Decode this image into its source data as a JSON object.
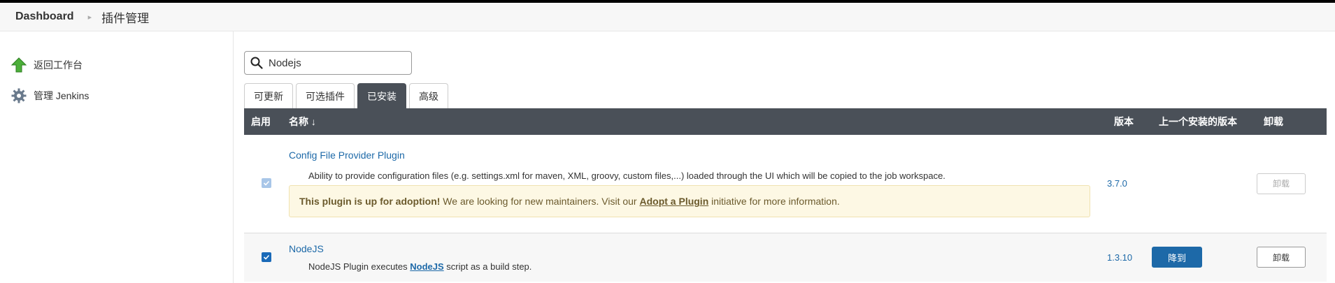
{
  "breadcrumb": {
    "home": "Dashboard",
    "current": "插件管理"
  },
  "sidebar": {
    "items": [
      {
        "label": "返回工作台",
        "icon": "up-arrow-icon"
      },
      {
        "label": "管理 Jenkins",
        "icon": "gear-icon"
      }
    ]
  },
  "search": {
    "value": "Nodejs",
    "placeholder": ""
  },
  "tabs": [
    {
      "label": "可更新",
      "active": false
    },
    {
      "label": "可选插件",
      "active": false
    },
    {
      "label": "已安装",
      "active": true
    },
    {
      "label": "高级",
      "active": false
    }
  ],
  "table": {
    "headers": {
      "enabled": "启用",
      "name": "名称 ↓",
      "version": "版本",
      "previous": "上一个安装的版本",
      "uninstall": "卸载"
    },
    "rows": [
      {
        "name": "Config File Provider Plugin",
        "description": "Ability to provide configuration files (e.g. settings.xml for maven, XML, groovy, custom files,...) loaded through the UI which will be copied to the job workspace.",
        "adoption_bold": "This plugin is up for adoption!",
        "adoption_text1": " We are looking for new maintainers. Visit our ",
        "adoption_link": "Adopt a Plugin",
        "adoption_text2": " initiative for more information.",
        "version": "3.7.0",
        "previous": "",
        "uninstall_label": "卸载",
        "enabled": true,
        "checkbox_disabled": true
      },
      {
        "name": "NodeJS",
        "desc_prefix": "NodeJS Plugin executes ",
        "desc_link": "NodeJS",
        "desc_suffix": " script as a build step.",
        "version": "1.3.10",
        "downgrade_label": "降到",
        "uninstall_label": "卸载",
        "enabled": true,
        "checkbox_disabled": false
      }
    ]
  },
  "colors": {
    "accent": "#1d69a8",
    "header_bg": "#4a5058",
    "adoption_bg": "#fdf8e4"
  }
}
